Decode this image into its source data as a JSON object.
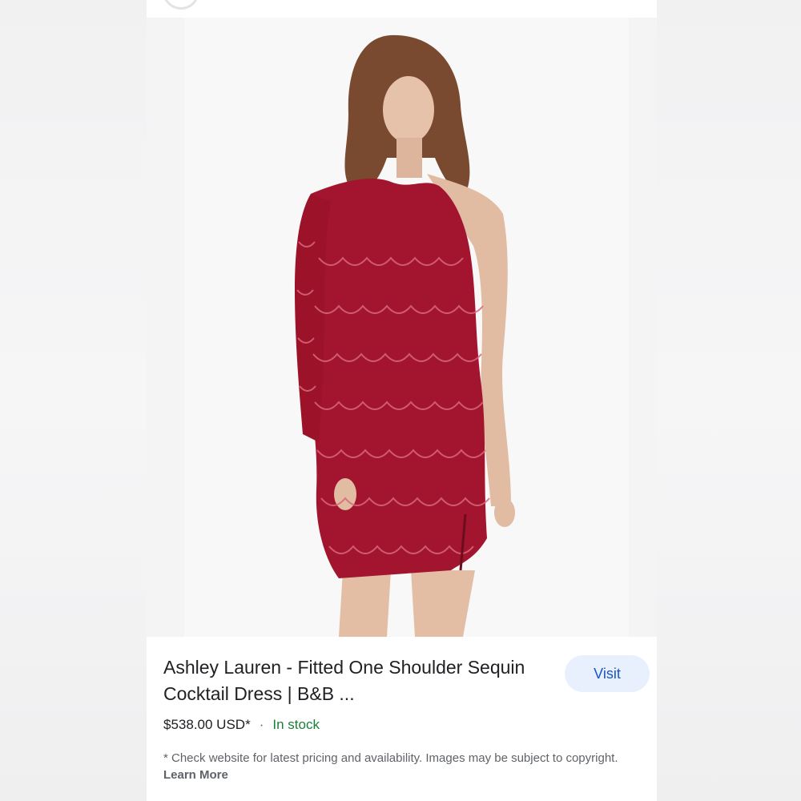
{
  "product": {
    "title": "Ashley Lauren - Fitted One Shoulder Sequin Cocktail Dress | B&B ...",
    "price": "$538.00 USD*",
    "separator": "·",
    "availability": "In stock",
    "visit_label": "Visit"
  },
  "disclaimer": {
    "text": "* Check website for latest pricing and availability. Images may be subject to copyright.",
    "link_label": "Learn More"
  },
  "colors": {
    "availability": "#188038",
    "visit_button_bg": "#e8f0fe",
    "visit_button_text": "#1a56c4",
    "dress": "#a3152e"
  }
}
